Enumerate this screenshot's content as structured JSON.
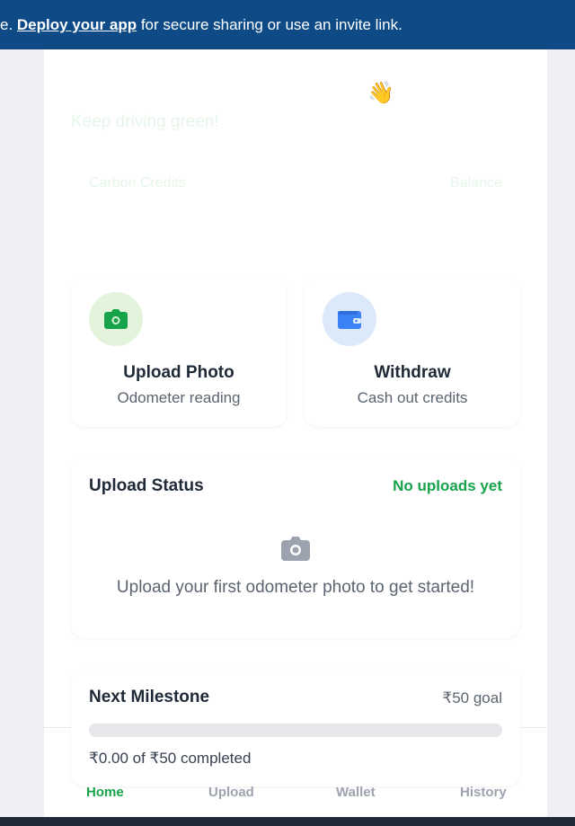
{
  "banner": {
    "prefix": "e. ",
    "link": "Deploy your app",
    "suffix": " for secure sharing or use an invite link."
  },
  "hero": {
    "wave_emoji": "👋",
    "greeting": "Keep driving green!",
    "carbon_credits_label": "Carbon Credits",
    "balance_label": "Balance"
  },
  "actions": [
    {
      "title": "Upload Photo",
      "subtitle": "Odometer reading",
      "icon": "camera-icon",
      "color": "#16a34a"
    },
    {
      "title": "Withdraw",
      "subtitle": "Cash out credits",
      "icon": "wallet-icon",
      "color": "#3b82f6"
    }
  ],
  "upload_status": {
    "title": "Upload Status",
    "badge": "No uploads yet",
    "empty_icon": "camera-icon",
    "empty_text": "Upload your first odometer photo to get started!"
  },
  "milestone": {
    "title": "Next Milestone",
    "goal": "₹50 goal",
    "progress_text": "₹0.00 of ₹50 completed",
    "progress_fraction": 0
  },
  "nav": [
    {
      "label": "Home",
      "active": true
    },
    {
      "label": "Upload",
      "active": false
    },
    {
      "label": "Wallet",
      "active": false
    },
    {
      "label": "History",
      "active": false
    }
  ],
  "colors": {
    "banner_bg": "#0d4a86",
    "accent_green": "#16a34a",
    "accent_blue": "#3b82f6"
  }
}
